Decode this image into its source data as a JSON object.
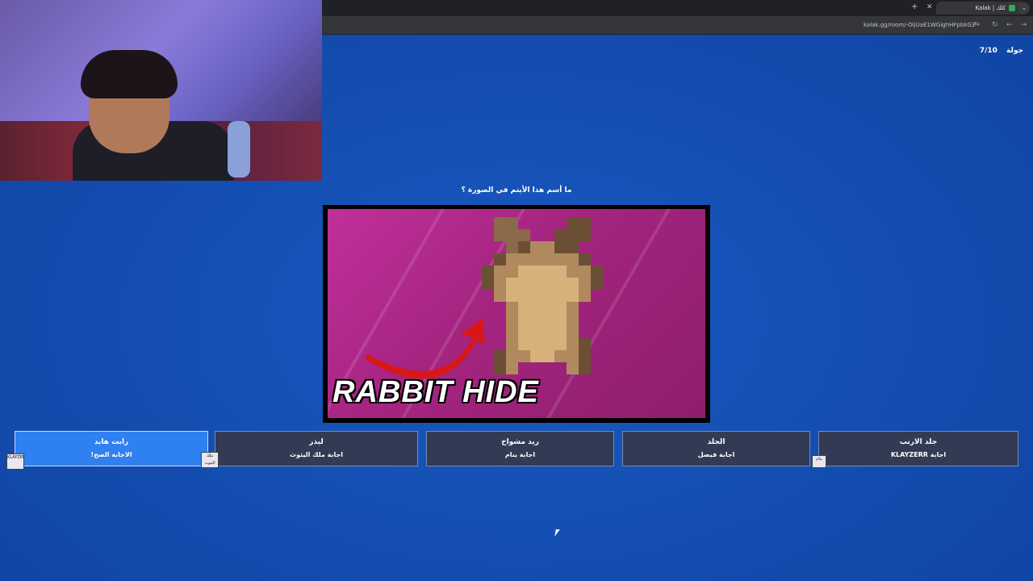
{
  "browser": {
    "tab_title": "Kalak | كلك",
    "url": "kalak.gg/room/-OIjUaE1WGighHFpbkG3",
    "new_tab_icon": "plus-icon",
    "close_icon": "close-icon"
  },
  "game": {
    "round_label": "جولة",
    "round_value": "7/10",
    "question": "ما أسم هذا الأيتم في الصورة ؟",
    "image_caption": "RABBIT HIDE",
    "answers": [
      {
        "label": "رابت هايد",
        "by": "الاجابة الصح!",
        "correct": true,
        "avatar": "KLAYZERR"
      },
      {
        "label": "ليذر",
        "by": "اجابة ملك اليثوث",
        "correct": false,
        "avatar": "ملك اليثوث"
      },
      {
        "label": "ريد مشواخ",
        "by": "اجابة ينام",
        "correct": false,
        "avatar": ""
      },
      {
        "label": "الجلد",
        "by": "اجابة فيصل",
        "correct": false,
        "avatar": ""
      },
      {
        "label": "جلد الارنب",
        "by": "اجابة KLAYZERR",
        "correct": false,
        "avatar": "ينام"
      }
    ]
  },
  "colors": {
    "background": "#1550b4",
    "correct_answer": "#2f80f0",
    "answer": "#323b53",
    "image_bg": "#a4247f"
  }
}
